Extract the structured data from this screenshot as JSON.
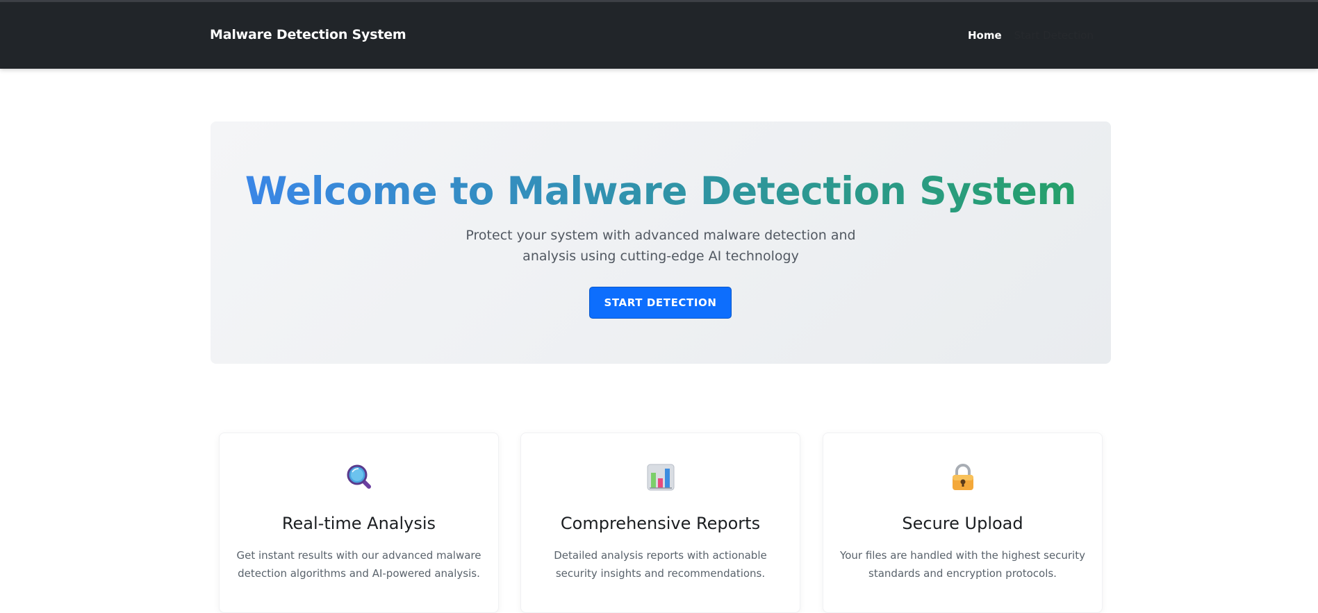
{
  "navbar": {
    "brand": "Malware Detection System",
    "links": [
      {
        "label": "Home",
        "active": true
      },
      {
        "label": "Start Detection",
        "active": false
      }
    ]
  },
  "hero": {
    "title": "Welcome to Malware Detection System",
    "subtitle": "Protect your system with advanced malware detection and analysis using cutting-edge AI technology",
    "button_label": "START DETECTION"
  },
  "features": [
    {
      "icon": "magnifying-glass-icon",
      "title": "Real-time Analysis",
      "text": "Get instant results with our advanced malware detection algorithms and AI-powered analysis."
    },
    {
      "icon": "bar-chart-icon",
      "title": "Comprehensive Reports",
      "text": "Detailed analysis reports with actionable security insights and recommendations."
    },
    {
      "icon": "lock-icon",
      "title": "Secure Upload",
      "text": "Your files are handled with the highest security standards and encryption protocols."
    }
  ],
  "colors": {
    "navbar_bg": "#212529",
    "primary": "#0d6efd",
    "gradient_start": "#3a86e6",
    "gradient_end": "#26a06a"
  }
}
